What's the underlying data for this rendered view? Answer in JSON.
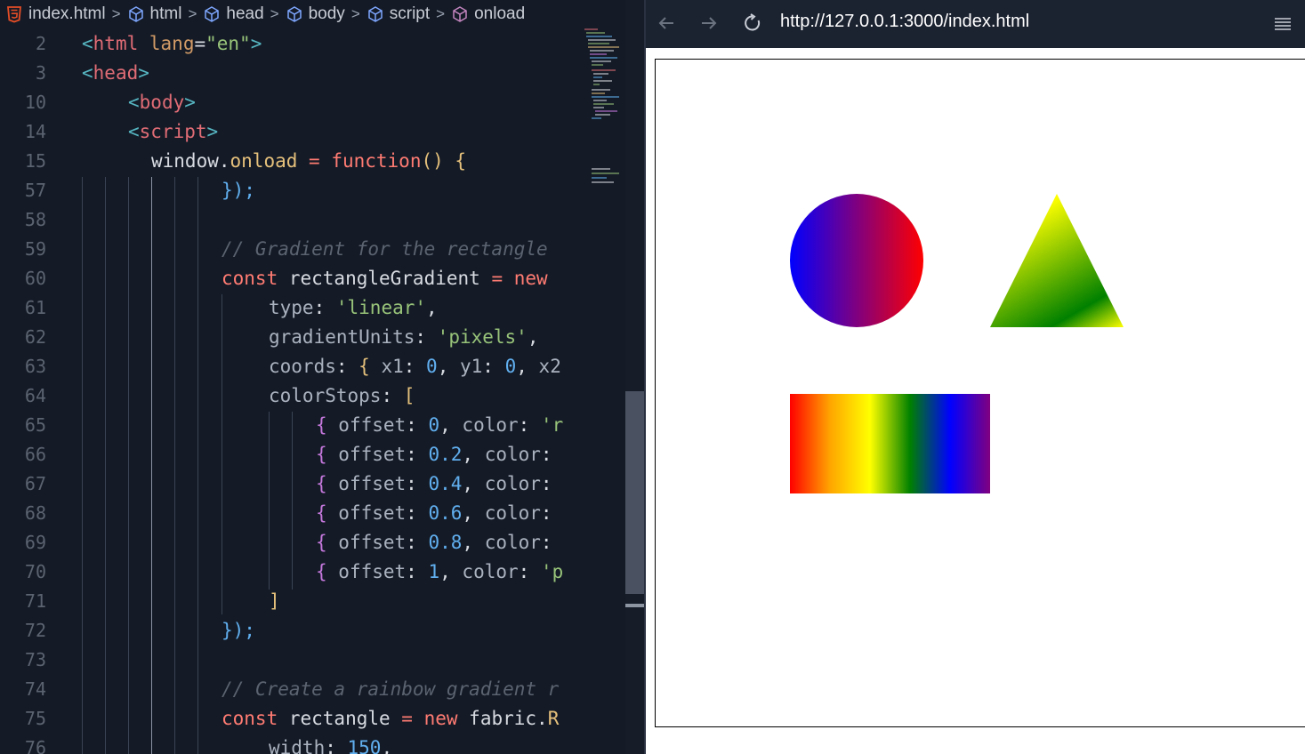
{
  "breadcrumb": {
    "items": [
      "index.html",
      "html",
      "head",
      "body",
      "script",
      "onload"
    ]
  },
  "code_lines": [
    {
      "n": "2"
    },
    {
      "n": "3"
    },
    {
      "n": "10"
    },
    {
      "n": "14"
    },
    {
      "n": "15"
    },
    {
      "n": "57"
    },
    {
      "n": "58"
    },
    {
      "n": "59"
    },
    {
      "n": "60"
    },
    {
      "n": "61"
    },
    {
      "n": "62"
    },
    {
      "n": "63"
    },
    {
      "n": "64"
    },
    {
      "n": "65"
    },
    {
      "n": "66"
    },
    {
      "n": "67"
    },
    {
      "n": "68"
    },
    {
      "n": "69"
    },
    {
      "n": "70"
    },
    {
      "n": "71"
    },
    {
      "n": "72"
    },
    {
      "n": "73"
    },
    {
      "n": "74"
    },
    {
      "n": "75"
    },
    {
      "n": "76"
    }
  ],
  "code_text": {
    "l2": [
      "<",
      "html",
      " ",
      "lang",
      "=",
      "\"en\"",
      ">"
    ],
    "l3": [
      "<",
      "head",
      ">"
    ],
    "l10": [
      "<",
      "body",
      ">"
    ],
    "l14": [
      "<",
      "script",
      ">"
    ],
    "l15": [
      "window",
      ".",
      "onload",
      " = ",
      "function",
      "() ",
      "{"
    ],
    "l57": [
      "}",
      ");"
    ],
    "l59": "// Gradient for the rectangle ",
    "l60": [
      "const",
      " rectangleGradient ",
      "=",
      " new",
      " "
    ],
    "l61": [
      "type",
      ": ",
      "'linear'",
      ","
    ],
    "l62": [
      "gradientUnits",
      ": ",
      "'pixels'",
      ","
    ],
    "l63": [
      "coords",
      ": ",
      "{",
      " x1",
      ": ",
      "0",
      ", ",
      "y1",
      ": ",
      "0",
      ", ",
      "x2"
    ],
    "l64": [
      "colorStops",
      ": ",
      "["
    ],
    "l65": [
      "{",
      " offset",
      ": ",
      "0",
      ", ",
      "color",
      ": ",
      "'r"
    ],
    "l66": [
      "{",
      " offset",
      ": ",
      "0.2",
      ", ",
      "color",
      ":"
    ],
    "l67": [
      "{",
      " offset",
      ": ",
      "0.4",
      ", ",
      "color",
      ":"
    ],
    "l68": [
      "{",
      " offset",
      ": ",
      "0.6",
      ", ",
      "color",
      ":"
    ],
    "l69": [
      "{",
      " offset",
      ": ",
      "0.8",
      ", ",
      "color",
      ":"
    ],
    "l70": [
      "{",
      " offset",
      ": ",
      "1",
      ", ",
      "color",
      ": ",
      "'p"
    ],
    "l71": "]",
    "l72": [
      "}",
      ");"
    ],
    "l74": "// Create a rainbow gradient r",
    "l75": [
      "const",
      " rectangle ",
      "=",
      " new",
      " fabric",
      ".",
      "R"
    ],
    "l76": [
      "width",
      ": ",
      "150",
      ","
    ]
  },
  "browser": {
    "url": "http://127.0.0.1:3000/index.html",
    "back_icon": "arrow-left-icon",
    "forward_icon": "arrow-right-icon",
    "reload_icon": "reload-icon",
    "menu_icon": "hamburger-menu-icon"
  },
  "canvas": {
    "circle": {
      "stops": [
        "#0000ff",
        "#ff0000"
      ]
    },
    "triangle": {
      "stops": [
        "#ffff00",
        "#008000",
        "#ffff00"
      ]
    },
    "rectangle": {
      "stops": [
        "#ff0000",
        "#ffa500",
        "#ffff00",
        "#008000",
        "#0000ff",
        "#800080"
      ]
    }
  },
  "colors": {
    "editor_bg": "#141b27",
    "browser_toolbar": "#1b2230",
    "html5_icon": "#e44d26",
    "cube_icon": "#7fa7ff",
    "onload_cube_icon": "#c586c0"
  }
}
